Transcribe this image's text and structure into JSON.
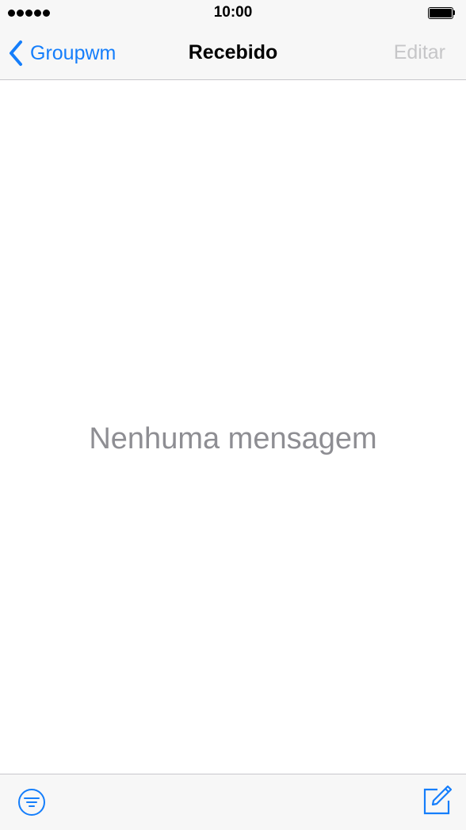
{
  "status_bar": {
    "time": "10:00",
    "signal_icon": "signal-dots-icon",
    "battery_icon": "battery-icon",
    "battery_level": 1.0
  },
  "nav_bar": {
    "back_label": "Groupwm",
    "title": "Recebido",
    "edit_label": "Editar"
  },
  "main": {
    "empty_message": "Nenhuma mensagem"
  },
  "toolbar": {
    "filter_icon": "filter-icon",
    "compose_icon": "compose-icon"
  },
  "colors": {
    "accent": "#157efb",
    "disabled_text": "#c6c6c8",
    "empty_text": "#8e8e93",
    "bar_background": "#f7f7f7"
  }
}
